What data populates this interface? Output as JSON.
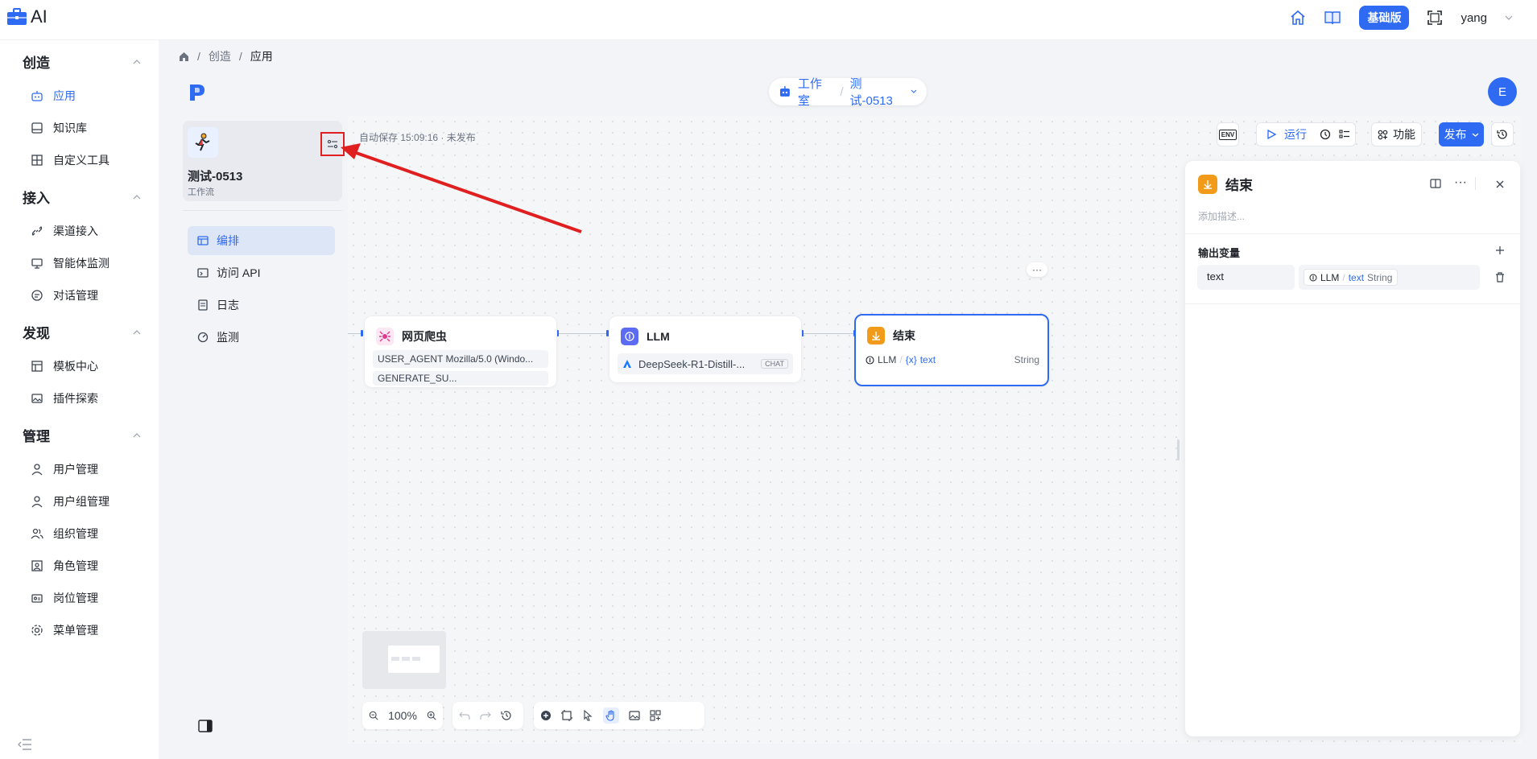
{
  "app": {
    "logo_text": "AI"
  },
  "topbar": {
    "tier_label": "基础版",
    "username": "yang"
  },
  "sidebar": {
    "groups": [
      {
        "label": "创造",
        "items": [
          {
            "label": "应用",
            "active": true
          },
          {
            "label": "知识库"
          },
          {
            "label": "自定义工具"
          }
        ]
      },
      {
        "label": "接入",
        "items": [
          {
            "label": "渠道接入"
          },
          {
            "label": "智能体监测"
          },
          {
            "label": "对话管理"
          }
        ]
      },
      {
        "label": "发现",
        "items": [
          {
            "label": "模板中心"
          },
          {
            "label": "插件探索"
          }
        ]
      },
      {
        "label": "管理",
        "items": [
          {
            "label": "用户管理"
          },
          {
            "label": "用户组管理"
          },
          {
            "label": "组织管理"
          },
          {
            "label": "角色管理"
          },
          {
            "label": "岗位管理"
          },
          {
            "label": "菜单管理"
          }
        ]
      }
    ]
  },
  "breadcrumb": {
    "items": [
      "创造",
      "应用"
    ],
    "sep": "/"
  },
  "workspace": {
    "label": "工作室",
    "sep": "/",
    "app_name": "测试-0513"
  },
  "user_avatar": {
    "initial": "E"
  },
  "app_card": {
    "name": "测试-0513",
    "type": "工作流"
  },
  "left_nav": [
    {
      "label": "编排",
      "active": true
    },
    {
      "label": "访问 API"
    },
    {
      "label": "日志"
    },
    {
      "label": "监测"
    }
  ],
  "canvas": {
    "autosave": "自动保存 15:09:16 · 未发布",
    "toolbar": {
      "env": "ENV",
      "run": "运行",
      "features": "功能",
      "publish": "发布"
    },
    "nodes": {
      "crawler": {
        "title": "网页爬虫",
        "fields": [
          "USER_AGENT Mozilla/5.0 (Windo...",
          "GENERATE_SU..."
        ]
      },
      "llm": {
        "title": "LLM",
        "model": "DeepSeek-R1-Distill-...",
        "model_tag": "CHAT"
      },
      "end": {
        "title": "结束",
        "src": "LLM",
        "var": "text",
        "var_prefix": "{x}",
        "type": "String",
        "more": "···"
      }
    },
    "zoom": "100%"
  },
  "drawer": {
    "title": "结束",
    "desc_placeholder": "添加描述...",
    "output_label": "输出变量",
    "var_name": "text",
    "ref_node": "LLM",
    "ref_var": "text",
    "ref_type": "String"
  },
  "colors": {
    "accent": "#2f6bf2",
    "annotation_red": "#e02020",
    "end_node": "#f29a1a",
    "crawler": "#e03a8e",
    "llm": "#5b6cf2"
  }
}
